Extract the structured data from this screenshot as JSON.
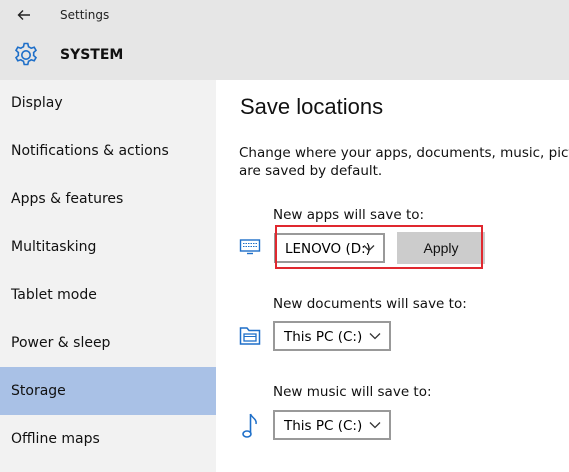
{
  "window": {
    "title": "Settings"
  },
  "header": {
    "section_title": "SYSTEM"
  },
  "sidebar": {
    "items": [
      {
        "label": "Display"
      },
      {
        "label": "Notifications & actions"
      },
      {
        "label": "Apps & features"
      },
      {
        "label": "Multitasking"
      },
      {
        "label": "Tablet mode"
      },
      {
        "label": "Power & sleep"
      },
      {
        "label": "Storage"
      },
      {
        "label": "Offline maps"
      }
    ],
    "selected_label": "Storage"
  },
  "main": {
    "heading": "Save locations",
    "description_line1": "Change where your apps, documents, music, pictu",
    "description_line2": "are saved by default.",
    "apps": {
      "label": "New apps will save to:",
      "selected": "LENOVO (D:)",
      "apply_label": "Apply"
    },
    "documents": {
      "label": "New documents will save to:",
      "selected": "This PC (C:)"
    },
    "music": {
      "label": "New music will save to:",
      "selected": "This PC (C:)"
    }
  },
  "icons": {
    "back": "back-arrow-icon",
    "settings": "gear-icon",
    "apps": "monitor-icon",
    "documents": "folder-icon",
    "music": "music-note-icon"
  },
  "colors": {
    "accent": "#1e6fc9",
    "selected_nav": "#a9c1e6",
    "highlight_box": "#e0282f",
    "header_bg": "#e6e6e6",
    "sidebar_bg": "#f2f2f2"
  }
}
